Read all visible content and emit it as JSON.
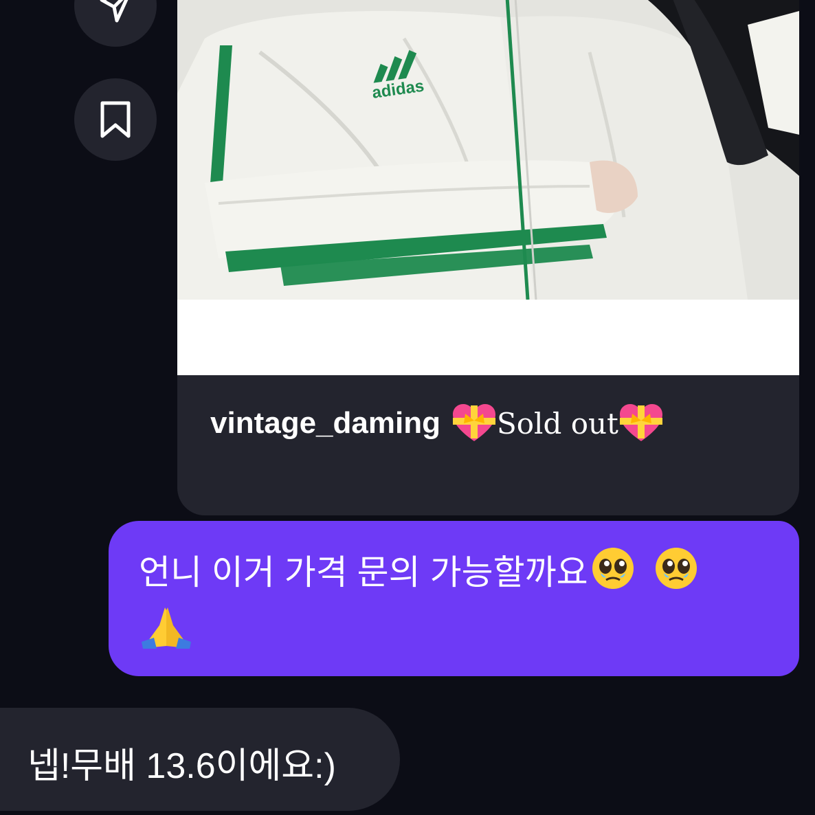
{
  "side_actions": {
    "share_icon": "paper-plane-icon",
    "save_icon": "bookmark-icon"
  },
  "shared_post": {
    "image_description_icon": "adidas-jacket-photo",
    "username": "vintage_daming",
    "caption": "Sold out",
    "caption_emoji": "heart-with-ribbon"
  },
  "messages": {
    "sent": {
      "text": "언니 이거 가격 문의 가능할까요",
      "emojis": [
        "pleading-face",
        "pleading-face",
        "folded-hands"
      ]
    },
    "received": {
      "text": "넵!무배 13.6이에요:)"
    }
  },
  "colors": {
    "background": "#0c0d16",
    "bubble_received": "#23242e",
    "bubble_sent": "#6e3af6",
    "jacket_stripe": "#1e8a4f"
  }
}
